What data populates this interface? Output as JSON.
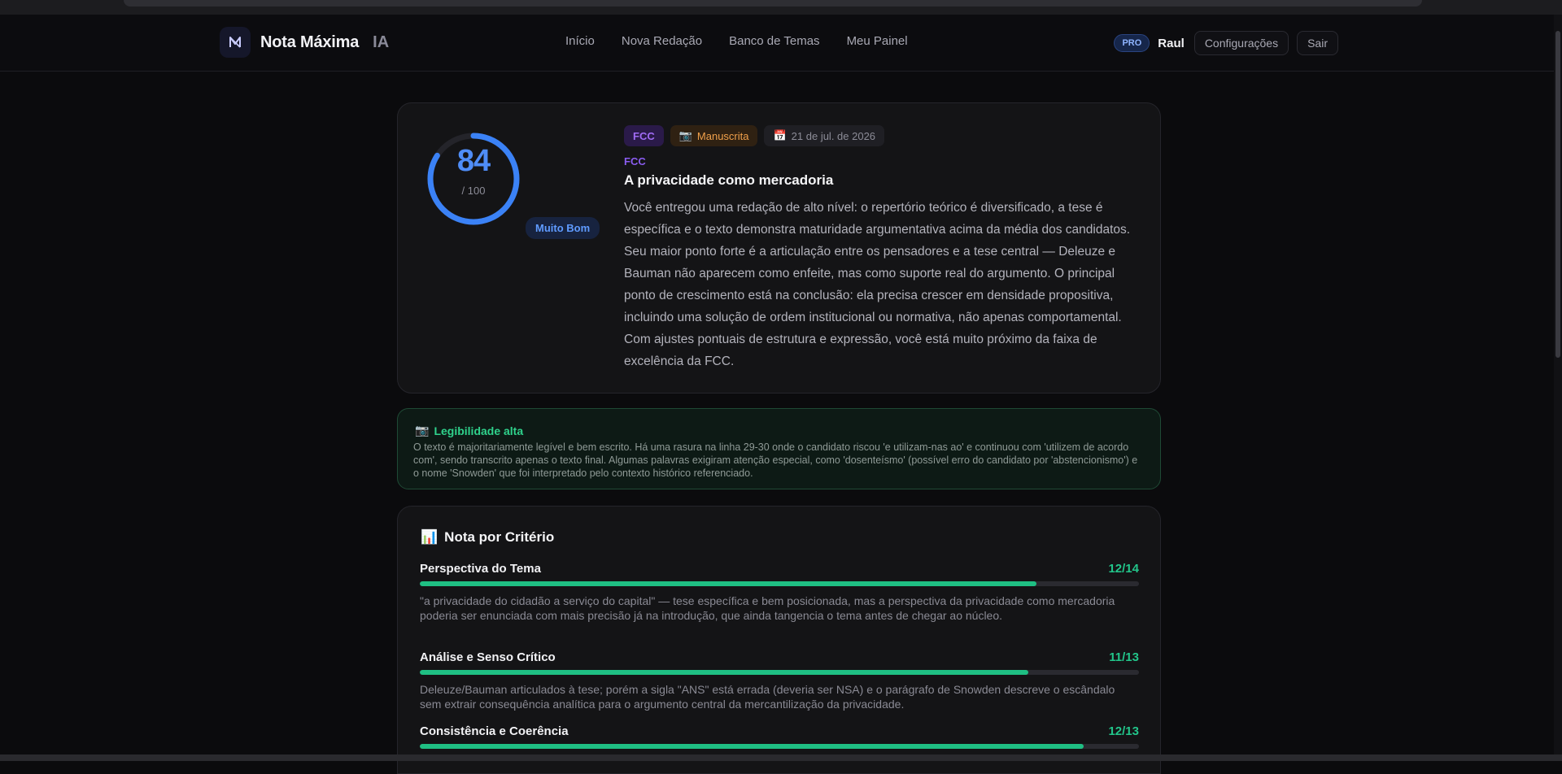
{
  "brand": {
    "name": "Nota Máxima",
    "suffix": "IA"
  },
  "nav": {
    "links": [
      "Início",
      "Nova Redação",
      "Banco de Temas",
      "Meu Painel"
    ]
  },
  "user": {
    "badge": "PRO",
    "name": "Raul",
    "settings_label": "Configurações",
    "logout_label": "Sair"
  },
  "result": {
    "score": "84",
    "score_max": "/ 100",
    "score_fraction": 0.84,
    "score_label": "Muito Bom",
    "tags": {
      "exam": "FCC",
      "type": "Manuscrita",
      "date": "21 de jul. de 2026"
    },
    "exam_label": "FCC",
    "title": "A privacidade como mercadoria",
    "feedback": "Você entregou uma redação de alto nível: o repertório teórico é diversificado, a tese é específica e o texto demonstra maturidade argumentativa acima da média dos candidatos. Seu maior ponto forte é a articulação entre os pensadores e a tese central — Deleuze e Bauman não aparecem como enfeite, mas como suporte real do argumento. O principal ponto de crescimento está na conclusão: ela precisa crescer em densidade propositiva, incluindo uma solução de ordem institucional ou normativa, não apenas comportamental. Com ajustes pontuais de estrutura e expressão, você está muito próximo da faixa de excelência da FCC."
  },
  "legibility": {
    "title": "Legibilidade alta",
    "text": "O texto é majoritariamente legível e bem escrito. Há uma rasura na linha 29-30 onde o candidato riscou 'e utilizam-nas ao' e continuou com 'utilizem de acordo com', sendo transcrito apenas o texto final. Algumas palavras exigiram atenção especial, como 'dosenteísmo' (possível erro do candidato por 'abstencionismo') e o nome 'Snowden' que foi interpretado pelo contexto histórico referenciado."
  },
  "criteria": {
    "title": "Nota por Critério",
    "items": [
      {
        "name": "Perspectiva do Tema",
        "score": "12/14",
        "fraction": 0.857,
        "desc": "\"a privacidade do cidadão a serviço do capital\" — tese específica e bem posicionada, mas a perspectiva da privacidade como mercadoria poderia ser enunciada com mais precisão já na introdução, que ainda tangencia o tema antes de chegar ao núcleo."
      },
      {
        "name": "Análise e Senso Crítico",
        "score": "11/13",
        "fraction": 0.846,
        "desc": "Deleuze/Bauman articulados à tese; porém a sigla \"ANS\" está errada (deveria ser NSA) e o parágrafo de Snowden descreve o escândalo sem extrair consequência analítica para o argumento central da mercantilização da privacidade."
      },
      {
        "name": "Consistência e Coerência",
        "score": "12/13",
        "fraction": 0.923,
        "desc": ""
      }
    ]
  },
  "colors": {
    "accent": "#4f8df7",
    "success": "#1fbf83",
    "background": "#0b0b0d"
  }
}
